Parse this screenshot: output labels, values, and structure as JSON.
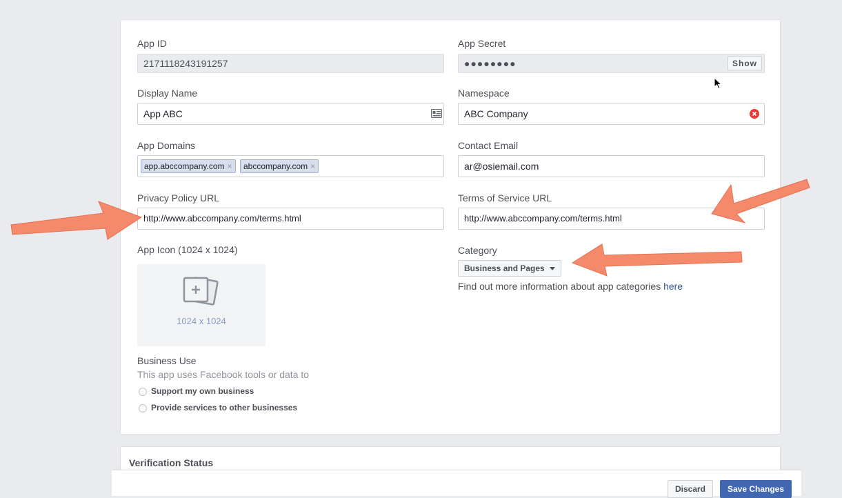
{
  "form": {
    "app_id": {
      "label": "App ID",
      "value": "2171118243191257"
    },
    "app_secret": {
      "label": "App Secret",
      "value": "●●●●●●●●",
      "button": "Show"
    },
    "display_name": {
      "label": "Display Name",
      "value": "App ABC",
      "icon": "contact-card-icon"
    },
    "namespace": {
      "label": "Namespace",
      "value": "ABC Company",
      "icon": "error-clear-icon"
    },
    "app_domains": {
      "label": "App Domains",
      "tokens": [
        "app.abccompany.com",
        "abccompany.com"
      ],
      "remove_glyph": "×"
    },
    "contact_email": {
      "label": "Contact Email",
      "value": "ar@osiemail.com"
    },
    "privacy_policy_url": {
      "label": "Privacy Policy URL",
      "value": "http://www.abccompany.com/terms.html"
    },
    "terms_of_service_url": {
      "label": "Terms of Service URL",
      "value": "http://www.abccompany.com/terms.html"
    },
    "app_icon": {
      "label": "App Icon (1024 x 1024)",
      "placeholder": "1024 x 1024"
    },
    "category": {
      "label": "Category",
      "value": "Business and Pages",
      "help_text": "Find out more information about app categories ",
      "help_link": "here"
    },
    "business_use": {
      "label": "Business Use",
      "description": "This app uses Facebook tools or data to",
      "options": [
        "Support my own business",
        "Provide services to other businesses"
      ]
    }
  },
  "verification": {
    "title": "Verification Status"
  },
  "footer": {
    "discard_label": "Discard",
    "save_label": "Save Changes"
  },
  "colors": {
    "annotation_arrow": "#f4896b",
    "primary_button": "#4267b2",
    "link": "#365899"
  }
}
